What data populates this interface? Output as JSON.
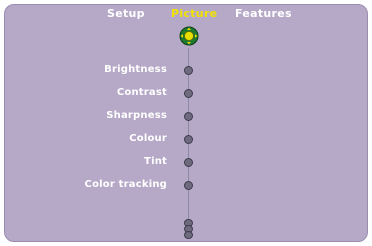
{
  "tabs": [
    {
      "label": "Setup",
      "active": false
    },
    {
      "label": "Picture",
      "active": true
    },
    {
      "label": "Features",
      "active": false
    }
  ],
  "menu": {
    "items": [
      {
        "label": "Brightness"
      },
      {
        "label": "Contrast"
      },
      {
        "label": "Sharpness"
      },
      {
        "label": "Colour"
      },
      {
        "label": "Tint"
      },
      {
        "label": "Color tracking"
      }
    ]
  },
  "icons": {
    "navigator": "joystick-icon",
    "slider_knob": "knob-icon",
    "more_indicator": "more-items-icon"
  },
  "colors": {
    "panel": "#b6a9c8",
    "text": "#ffffff",
    "active_tab": "#f2e200",
    "knob": "#6e6b7e",
    "navigator_outer": "#1f7a2e",
    "navigator_inner": "#e8e000"
  }
}
